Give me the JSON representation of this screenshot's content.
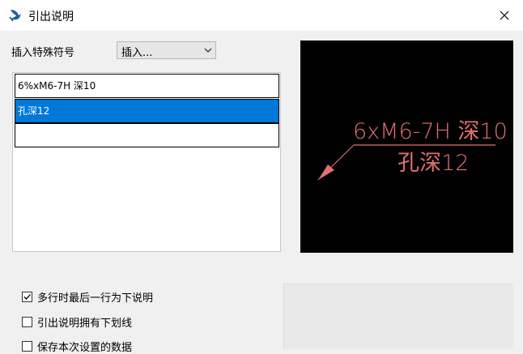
{
  "window": {
    "title": "引出说明",
    "icon": "app-logo-icon",
    "close_glyph": "✕"
  },
  "symbol": {
    "label": "插入特殊符号",
    "dropdown_value": "插入..."
  },
  "lines": [
    {
      "text": "6%xM6-7H 深10",
      "selected": false
    },
    {
      "text": "孔深12",
      "selected": true
    },
    {
      "text": "",
      "selected": false
    }
  ],
  "preview": {
    "line1": "6xM6-7H 深10",
    "line2": "孔深12",
    "text_color": "#e07070",
    "background": "#000000"
  },
  "options": [
    {
      "label": "多行时最后一行为下说明",
      "checked": true
    },
    {
      "label": "引出说明拥有下划线",
      "checked": false
    },
    {
      "label": "保存本次设置的数据",
      "checked": false
    }
  ],
  "colors": {
    "selection": "#0078d7"
  }
}
